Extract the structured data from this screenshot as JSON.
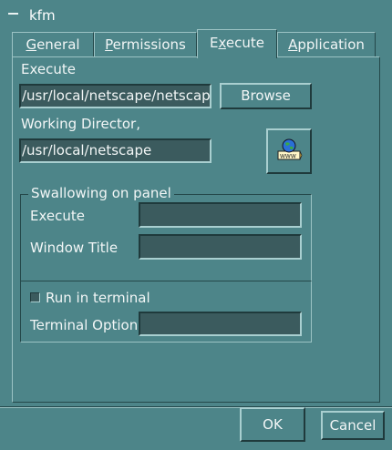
{
  "window": {
    "title": "kfm",
    "menu_icon": "window-menu-dash-icon"
  },
  "tabs": [
    {
      "label": "General",
      "active": false
    },
    {
      "label": "Permissions",
      "active": false
    },
    {
      "label": "Execute",
      "active": true
    },
    {
      "label": "Application",
      "active": false
    }
  ],
  "execute": {
    "label": "Execute",
    "value": "/usr/local/netscape/netscape",
    "browse_label": "Browse"
  },
  "working_directory": {
    "label": "Working Director,",
    "value": "/usr/local/netscape",
    "icon": "netscape-www-icon"
  },
  "swallowing": {
    "legend": "Swallowing on panel",
    "execute_label": "Execute",
    "execute_value": "",
    "window_title_label": "Window Title",
    "window_title_value": ""
  },
  "terminal": {
    "run_in_terminal_label": "Run in terminal",
    "run_in_terminal_checked": false,
    "option_label": "Terminal Option",
    "option_value": ""
  },
  "footer": {
    "ok_label": "OK",
    "cancel_label": "Cancel"
  }
}
